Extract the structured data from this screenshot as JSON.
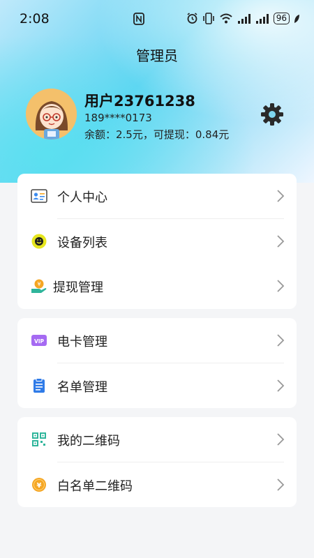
{
  "status_bar": {
    "time": "2:08",
    "battery": "96",
    "icons": [
      "nfc-icon",
      "alarm-icon",
      "vibrate-icon",
      "wifi-icon",
      "signal-icon",
      "signal-icon",
      "battery-icon",
      "leaf-icon"
    ]
  },
  "header": {
    "title": "管理员"
  },
  "profile": {
    "username": "用户23761238",
    "phone": "189****0173",
    "balance_text": "余额：2.5元，可提现：0.84元"
  },
  "groups": [
    {
      "items": [
        {
          "label": "个人中心",
          "icon": "id-card-icon"
        },
        {
          "label": "设备列表",
          "icon": "device-icon"
        },
        {
          "label": "提现管理",
          "icon": "withdraw-icon"
        }
      ]
    },
    {
      "items": [
        {
          "label": "电卡管理",
          "icon": "vip-card-icon"
        },
        {
          "label": "名单管理",
          "icon": "clipboard-icon"
        }
      ]
    },
    {
      "items": [
        {
          "label": "我的二维码",
          "icon": "qr-code-icon"
        },
        {
          "label": "白名单二维码",
          "icon": "coin-icon"
        }
      ]
    }
  ],
  "colors": {
    "accent_blue": "#3b8cf0",
    "vip_purple": "#9a5cf0",
    "green": "#2fb59b",
    "orange": "#f5a623"
  }
}
